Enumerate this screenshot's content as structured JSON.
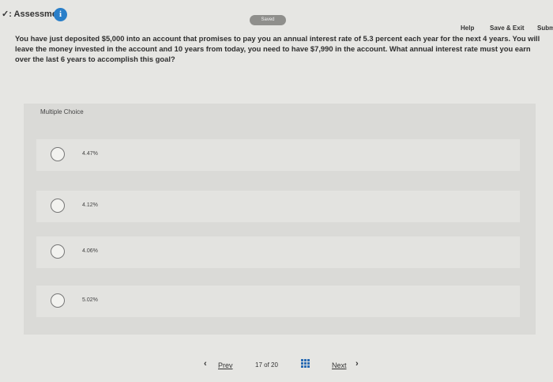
{
  "header": {
    "title": "✓: Assessment",
    "info_icon": "i",
    "saved": "Saved",
    "help": "Help",
    "save_exit": "Save & Exit",
    "submit": "Subm"
  },
  "question": {
    "text": "You have just deposited $5,000 into an account that promises to pay you an annual interest rate of 5.3 percent each year for the next 4 years. You will leave the money invested in the account and 10 years from today, you need to have $7,990 in the account. What annual interest rate must you earn over the last 6 years to accomplish this goal?"
  },
  "choices": {
    "label": "Multiple Choice",
    "options": [
      "4.47%",
      "4.12%",
      "4.06%",
      "5.02%"
    ]
  },
  "pagination": {
    "prev_label": "Prev",
    "next_label": "Next",
    "current": "17",
    "of": "of",
    "total": "20",
    "prev_icon": "chevron-left-icon",
    "next_icon": "chevron-right-icon",
    "grid_icon": "grid-icon"
  }
}
